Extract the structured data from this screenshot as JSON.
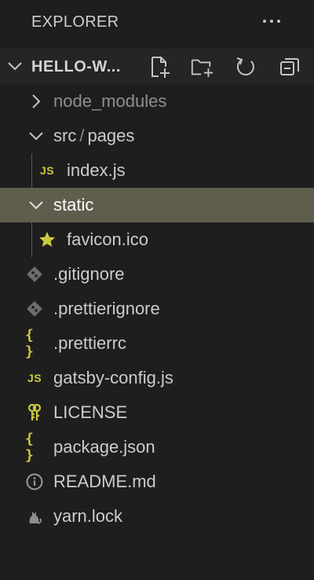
{
  "header": {
    "title": "EXPLORER",
    "more_icon": "ellipsis-icon"
  },
  "section": {
    "title": "HELLO-W...",
    "actions": [
      "new-file-icon",
      "new-folder-icon",
      "refresh-icon",
      "collapse-all-icon"
    ]
  },
  "tree": {
    "node_modules": "node_modules",
    "src": "src",
    "src_sep": "/",
    "pages": "pages",
    "index_js": "index.js",
    "static": "static",
    "favicon": "favicon.ico",
    "gitignore": ".gitignore",
    "prettierignore": ".prettierignore",
    "prettierrc": ".prettierrc",
    "gatsby_config": "gatsby-config.js",
    "license": "LICENSE",
    "package_json": "package.json",
    "readme": "README.md",
    "yarn_lock": "yarn.lock"
  },
  "icon_labels": {
    "js": "JS",
    "braces": "{ }"
  },
  "colors": {
    "background": "#1e1e1e",
    "selected_row": "#5f5d4c",
    "js_yellow": "#cbcb41",
    "git_grey": "#6d6d6d"
  }
}
